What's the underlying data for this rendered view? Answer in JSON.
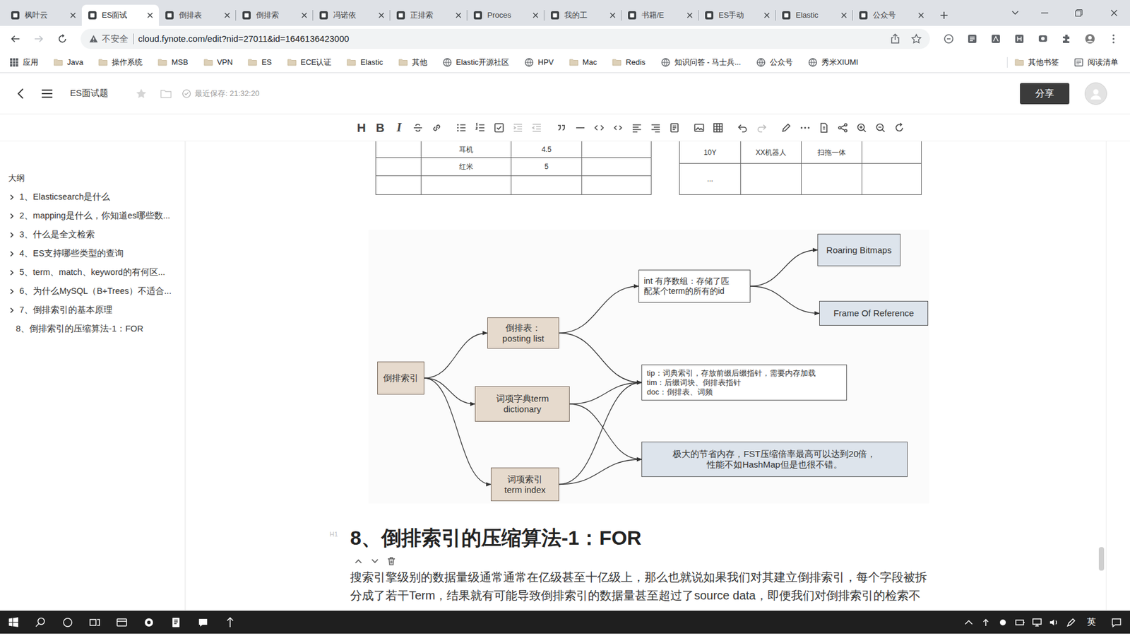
{
  "browser": {
    "tabs": [
      {
        "label": "枫叶云",
        "selected": false
      },
      {
        "label": "ES面试",
        "selected": true
      },
      {
        "label": "倒排表",
        "selected": false
      },
      {
        "label": "倒排索",
        "selected": false
      },
      {
        "label": "冯诺依",
        "selected": false
      },
      {
        "label": "正排索",
        "selected": false
      },
      {
        "label": "Proces",
        "selected": false
      },
      {
        "label": "我的工",
        "selected": false
      },
      {
        "label": "书籍/E",
        "selected": false
      },
      {
        "label": "ES手动",
        "selected": false
      },
      {
        "label": "Elastic",
        "selected": false
      },
      {
        "label": "公众号",
        "selected": false
      }
    ],
    "security": "不安全",
    "url": "cloud.fynote.com/edit?nid=27011&id=1646136423000",
    "bookmarks": [
      {
        "label": "应用",
        "kind": "apps"
      },
      {
        "label": "Java",
        "kind": "folder"
      },
      {
        "label": "操作系统",
        "kind": "folder"
      },
      {
        "label": "MSB",
        "kind": "folder"
      },
      {
        "label": "VPN",
        "kind": "folder"
      },
      {
        "label": "ES",
        "kind": "folder"
      },
      {
        "label": "ECE认证",
        "kind": "folder"
      },
      {
        "label": "Elastic",
        "kind": "folder"
      },
      {
        "label": "其他",
        "kind": "folder"
      },
      {
        "label": "Elastic开源社区",
        "kind": "link"
      },
      {
        "label": "HPV",
        "kind": "link"
      },
      {
        "label": "Mac",
        "kind": "folder"
      },
      {
        "label": "Redis",
        "kind": "folder"
      },
      {
        "label": "知识问答 - 马士兵...",
        "kind": "link"
      },
      {
        "label": "公众号",
        "kind": "link"
      },
      {
        "label": "秀米XIUMI",
        "kind": "link"
      }
    ],
    "bookmarks_right": [
      {
        "label": "其他书签",
        "kind": "folder"
      },
      {
        "label": "阅读清单",
        "kind": "reading"
      }
    ]
  },
  "app": {
    "title": "ES面试题",
    "saved": "最近保存: 21:32:20",
    "share": "分享",
    "toolbar_letters": [
      "H",
      "B",
      "I"
    ]
  },
  "outline": {
    "title": "大纲",
    "items": [
      {
        "text": "1、Elasticsearch是什么",
        "has_children": true,
        "expanded": false
      },
      {
        "text": "2、mapping是什么，你知道es哪些数...",
        "has_children": true,
        "expanded": false
      },
      {
        "text": "3、什么是全文检索",
        "has_children": true,
        "expanded": false
      },
      {
        "text": "4、ES支持哪些类型的查询",
        "has_children": true,
        "expanded": false
      },
      {
        "text": "5、term、match、keyword的有何区...",
        "has_children": true,
        "expanded": false
      },
      {
        "text": "6、为什么MySQL（B+Trees）不适合...",
        "has_children": true,
        "expanded": false
      },
      {
        "text": "7、倒排索引的基本原理",
        "has_children": true,
        "expanded": false
      },
      {
        "text": "8、倒排索引的压缩算法-1：FOR",
        "has_children": false,
        "expanded": false
      }
    ]
  },
  "document": {
    "table_left": [
      [
        "",
        "耳机",
        "4.5",
        ""
      ],
      [
        "",
        "红米",
        "5",
        ""
      ],
      [
        "",
        "",
        "",
        ""
      ]
    ],
    "table_right": [
      [
        "10Y",
        "XX机器人",
        "扫拖一体",
        ""
      ],
      [
        "...",
        "",
        "",
        ""
      ]
    ],
    "diagram": {
      "nodes": [
        {
          "lines": [
            "倒排索引"
          ],
          "kind": "core"
        },
        {
          "lines": [
            "倒排表：",
            "posting list"
          ],
          "kind": "core"
        },
        {
          "lines": [
            "词项字典term",
            "dictionary"
          ],
          "kind": "core"
        },
        {
          "lines": [
            "词项索引",
            "term index"
          ],
          "kind": "core"
        },
        {
          "lines": [
            "int 有序数组：存储了匹",
            "配某个term的所有的id"
          ],
          "kind": "note"
        },
        {
          "lines": [
            "Roaring Bitmaps"
          ],
          "kind": "tech"
        },
        {
          "lines": [
            "Frame Of Reference"
          ],
          "kind": "tech"
        },
        {
          "lines": [
            "tip：词典索引，存放前缀后缀指针，需要内存加载",
            "tim：后缀词块、倒排表指针",
            "doc：倒排表、词频"
          ],
          "kind": "list"
        },
        {
          "lines": [
            "极大的节省内存，FST压缩倍率最高可以达到20倍，",
            "性能不如HashMap但是也很不错。"
          ],
          "kind": "tech"
        }
      ],
      "edges": [
        [
          0,
          1
        ],
        [
          0,
          2
        ],
        [
          0,
          3
        ],
        [
          1,
          4
        ],
        [
          1,
          7
        ],
        [
          2,
          7
        ],
        [
          2,
          8
        ],
        [
          3,
          7
        ],
        [
          3,
          8
        ],
        [
          4,
          5
        ],
        [
          4,
          6
        ]
      ]
    },
    "heading_marker": "H1",
    "heading": "8、倒排索引的压缩算法-1：FOR",
    "paragraph_lines": [
      "搜索引擎级别的数据量级通常通常在亿级甚至十亿级上，那么也就说如果我们对其建立倒排索引，每个字段被拆",
      "分成了若干Term，结果就有可能导致倒排索引的数据量甚至超过了source data，即便我们对倒排索引的检索不"
    ]
  },
  "taskbar": {
    "ime": "英"
  }
}
